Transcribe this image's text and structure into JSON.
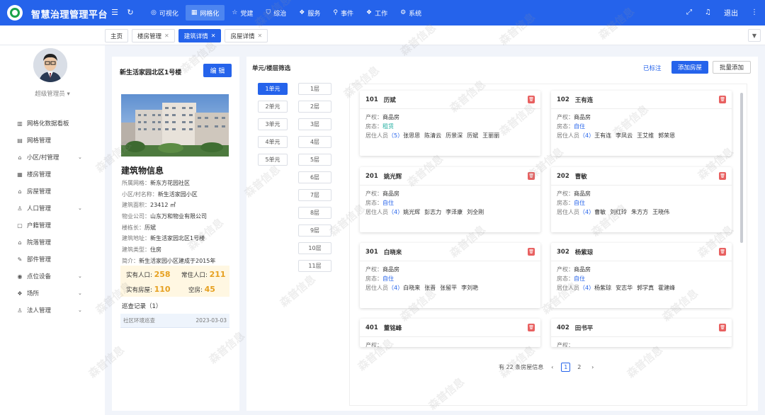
{
  "app": {
    "title": "智慧治理管理平台"
  },
  "header": {
    "nav": [
      {
        "label": "可视化",
        "icon": "radar-icon"
      },
      {
        "label": "网格化",
        "icon": "grid-icon",
        "active": true
      },
      {
        "label": "党建",
        "icon": "star-icon"
      },
      {
        "label": "综治",
        "icon": "shield-icon"
      },
      {
        "label": "服务",
        "icon": "service-icon"
      },
      {
        "label": "事件",
        "icon": "location-icon"
      },
      {
        "label": "工作",
        "icon": "work-icon"
      },
      {
        "label": "系统",
        "icon": "system-icon"
      }
    ],
    "logout": "退出"
  },
  "tabs": [
    {
      "label": "主页",
      "closable": false
    },
    {
      "label": "楼房管理",
      "closable": true
    },
    {
      "label": "建筑详情",
      "closable": true,
      "active": true
    },
    {
      "label": "房屋详情",
      "closable": true
    }
  ],
  "sidebar": {
    "user": "超级管理员",
    "items": [
      {
        "label": "网格化数据看板",
        "icon": "chart-icon"
      },
      {
        "label": "网格管理",
        "icon": "grid-icon"
      },
      {
        "label": "小区/村管理",
        "icon": "community-icon",
        "expand": true
      },
      {
        "label": "楼房管理",
        "icon": "building-icon"
      },
      {
        "label": "房屋管理",
        "icon": "house-icon"
      },
      {
        "label": "人口管理",
        "icon": "person-icon",
        "expand": true
      },
      {
        "label": "户籍管理",
        "icon": "household-icon"
      },
      {
        "label": "院落管理",
        "icon": "courtyard-icon"
      },
      {
        "label": "部件管理",
        "icon": "component-icon"
      },
      {
        "label": "点位设备",
        "icon": "device-icon",
        "expand": true
      },
      {
        "label": "场所",
        "icon": "place-icon",
        "expand": true
      },
      {
        "label": "法人管理",
        "icon": "legal-icon",
        "expand": true
      }
    ]
  },
  "building": {
    "name": "新生活家园北区1号楼",
    "edit_label": "编 辑",
    "section_title": "建筑物信息",
    "info": [
      {
        "label": "所属网格：",
        "value": "新东方花园社区"
      },
      {
        "label": "小区/村名称：",
        "value": "新生活家园小区"
      },
      {
        "label": "建筑面积：",
        "value": "23412 ㎡"
      },
      {
        "label": "物业公司：",
        "value": "山东万和物业有限公司"
      },
      {
        "label": "楼栋长：",
        "value": "历斌"
      },
      {
        "label": "建筑地址：",
        "value": "新生活家园北区1号楼"
      },
      {
        "label": "建筑类型：",
        "value": "住房"
      },
      {
        "label": "简介：",
        "value": "新生活家园小区建成于2015年"
      }
    ],
    "stats": {
      "actual_pop_label": "实有人口:",
      "actual_pop": "258",
      "resident_pop_label": "常住人口:",
      "resident_pop": "211",
      "actual_house_label": "实有房屋:",
      "actual_house": "110",
      "vacant_label": "空房:",
      "vacant": "45"
    },
    "patrol": {
      "title": "巡查记录（1）",
      "item": "社区环境巡查",
      "date": "2023-03-03"
    }
  },
  "filter": {
    "title": "单元/楼层筛选",
    "marked": "已标注",
    "add_label": "添加房屋",
    "batch_label": "批量添加",
    "units": [
      "1单元",
      "2单元",
      "3单元",
      "4单元",
      "5单元"
    ],
    "floors": [
      "1层",
      "2层",
      "3层",
      "4层",
      "5层",
      "6层",
      "7层",
      "8层",
      "9层",
      "10层",
      "11层"
    ]
  },
  "rooms": [
    {
      "no": "101",
      "head": "历斌",
      "prop_label": "产权：",
      "prop": "商品房",
      "state_label": "房态：",
      "state": "租赁",
      "rent": true,
      "res_label": "居住人员",
      "count": "（5）",
      "names": [
        "张思思",
        "陈清云",
        "历景深",
        "历斌",
        "王丽丽"
      ]
    },
    {
      "no": "102",
      "head": "王有连",
      "prop_label": "产权：",
      "prop": "商品房",
      "state_label": "房态：",
      "state": "自住",
      "rent": false,
      "res_label": "居住人员",
      "count": "（4）",
      "names": [
        "王有连",
        "李凤云",
        "王艾维",
        "郭荣恩"
      ]
    },
    {
      "no": "201",
      "head": "姚光辉",
      "prop_label": "产权：",
      "prop": "商品房",
      "state_label": "房态：",
      "state": "自住",
      "rent": false,
      "res_label": "居住人员",
      "count": "（4）",
      "names": [
        "姚光辉",
        "彭志力",
        "李泽康",
        "刘全刚"
      ]
    },
    {
      "no": "202",
      "head": "曹敏",
      "prop_label": "产权：",
      "prop": "商品房",
      "state_label": "房态：",
      "state": "自住",
      "rent": false,
      "res_label": "居住人员",
      "count": "（4）",
      "names": [
        "曹敏",
        "刘红玲",
        "朱方方",
        "王晓伟"
      ]
    },
    {
      "no": "301",
      "head": "白晓来",
      "prop_label": "产权：",
      "prop": "商品房",
      "state_label": "房态：",
      "state": "自住",
      "rent": false,
      "res_label": "居住人员",
      "count": "（4）",
      "names": [
        "白晓来",
        "张晋",
        "张留平",
        "李刘艳"
      ]
    },
    {
      "no": "302",
      "head": "杨紫琼",
      "prop_label": "产权：",
      "prop": "商品房",
      "state_label": "房态：",
      "state": "自住",
      "rent": false,
      "res_label": "居住人员",
      "count": "（4）",
      "names": [
        "杨紫琼",
        "安志华",
        "郭学真",
        "霍建峰"
      ]
    },
    {
      "no": "401",
      "head": "董铭峰",
      "prop_label": "产权：",
      "prop": "",
      "state_label": "",
      "state": "",
      "rent": false,
      "res_label": "",
      "count": "",
      "names": []
    },
    {
      "no": "402",
      "head": "田书平",
      "prop_label": "产权：",
      "prop": "",
      "state_label": "",
      "state": "",
      "rent": false,
      "res_label": "",
      "count": "",
      "names": []
    }
  ],
  "pagination": {
    "total_text": "有 22 条房屋信息",
    "pages": [
      "1",
      "2"
    ]
  },
  "watermark": "森普信息"
}
